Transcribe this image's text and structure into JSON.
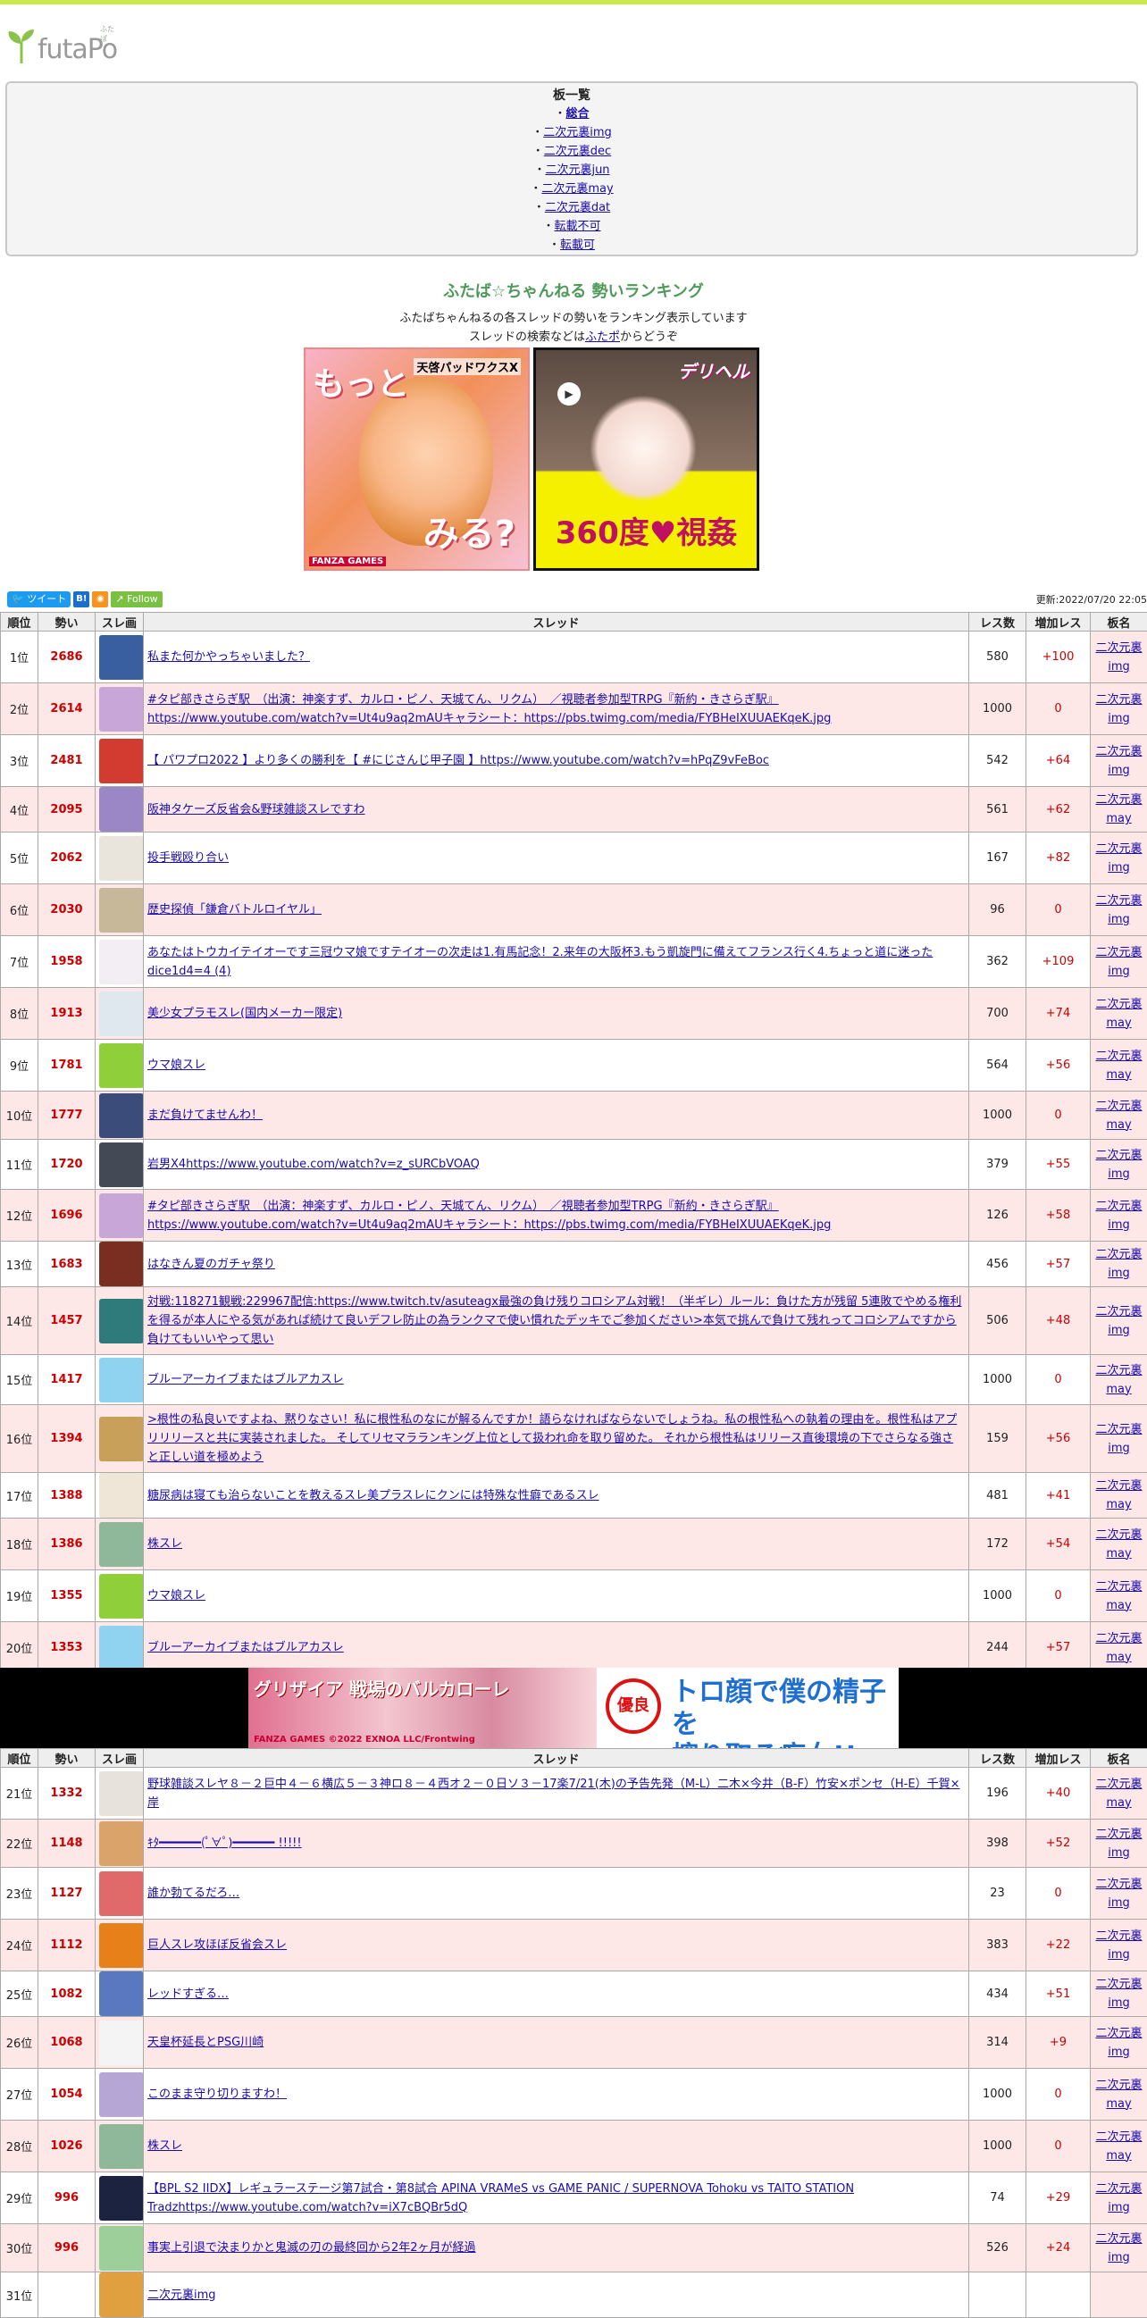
{
  "site": {
    "logo": "futaPo",
    "logo_sub": "ふたぽ",
    "updated": "更新:2022/07/20 22:05"
  },
  "boards": {
    "heading": "板一覧",
    "items": [
      {
        "label": "総合",
        "active": true
      },
      {
        "label": "二次元裏img"
      },
      {
        "label": "二次元裏dec"
      },
      {
        "label": "二次元裏jun"
      },
      {
        "label": "二次元裏may"
      },
      {
        "label": "二次元裏dat"
      },
      {
        "label": "転載不可"
      },
      {
        "label": "転載可"
      }
    ]
  },
  "ranking": {
    "title": "ふたば☆ちゃんねる 勢いランキング",
    "desc1": "ふたばちゃんねるの各スレッドの勢いをランキング表示しています",
    "desc2_pre": "スレッドの検索などは",
    "desc2_link": "ふたポ",
    "desc2_post": "からどうぞ"
  },
  "ads": {
    "ad1_big1": "もっと",
    "ad1_big2": "みる?",
    "ad1_small": "天啓パッドワクスX",
    "ad1_foot": "FANZA GAMES",
    "ad2_logo": "デリヘル",
    "ad2_big": "360度♥視姦",
    "mid_title": "グリザイア 戦場のバルカローレ",
    "mid_foot": "FANZA GAMES ©2022 EXNOA LLC/Frontwing",
    "mid_badge": "優良",
    "mid_line1": "トロ顔で僕の精子を",
    "mid_line2": "搾り取る痴女!!"
  },
  "social": {
    "tweet": "ツイート",
    "bi": "B!",
    "rss": "rss",
    "follow": "Follow"
  },
  "table_headers": {
    "rank": "順位",
    "power": "勢い",
    "img": "スレ画",
    "thread": "スレッド",
    "res": "レス数",
    "inc": "増加レス",
    "board": "板名"
  },
  "threads": [
    {
      "rank": "1位",
      "power": "2686",
      "title": "私また何かやっちゃいました？",
      "res": "580",
      "inc": "+100",
      "board": "二次元裏img",
      "thumb": "#3a5fa0"
    },
    {
      "rank": "2位",
      "power": "2614",
      "title": "#タピ部きさらぎ駅　（出演：神楽すず、カルロ・ピノ、天城てん、リクム）　／視聴者参加型TRPG『新約・きさらぎ駅』 https://www.youtube.com/watch?v=Ut4u9aq2mAUキャラシート：https://pbs.twimg.com/media/FYBHeIXUUAEKqeK.jpg",
      "res": "1000",
      "inc": "0",
      "board": "二次元裏img",
      "thumb": "#c9a6d8"
    },
    {
      "rank": "3位",
      "power": "2481",
      "title": "【 パワプロ2022 】より多くの勝利を【 #にじさんじ甲子園 】https://www.youtube.com/watch?v=hPqZ9vFeBoc",
      "res": "542",
      "inc": "+64",
      "board": "二次元裏img",
      "thumb": "#d23b2f"
    },
    {
      "rank": "4位",
      "power": "2095",
      "title": "阪神タケーズ反省会&野球雑談スレですわ",
      "res": "561",
      "inc": "+62",
      "board": "二次元裏may",
      "thumb": "#9b86c6"
    },
    {
      "rank": "5位",
      "power": "2062",
      "title": "投手戦殴り合い",
      "res": "167",
      "inc": "+82",
      "board": "二次元裏img",
      "thumb": "#e9e4dc"
    },
    {
      "rank": "6位",
      "power": "2030",
      "title": "歴史探偵「鎌倉バトルロイヤル」",
      "res": "96",
      "inc": "0",
      "board": "二次元裏img",
      "thumb": "#c8b89a"
    },
    {
      "rank": "7位",
      "power": "1958",
      "title": "あなたはトウカイテイオーです三冠ウマ娘ですテイオーの次走は1.有馬記念！2.来年の大阪杯3.もう凱旋門に備えてフランス行く4.ちょっと道に迷ったdice1d4=4 (4)",
      "res": "362",
      "inc": "+109",
      "board": "二次元裏img",
      "thumb": "#f3eef3"
    },
    {
      "rank": "8位",
      "power": "1913",
      "title": "美少女プラモスレ(国内メーカー限定)",
      "res": "700",
      "inc": "+74",
      "board": "二次元裏may",
      "thumb": "#dfe8ef"
    },
    {
      "rank": "9位",
      "power": "1781",
      "title": "ウマ娘スレ",
      "res": "564",
      "inc": "+56",
      "board": "二次元裏may",
      "thumb": "#8fcf3a"
    },
    {
      "rank": "10位",
      "power": "1777",
      "title": "まだ負けてませんわ！",
      "res": "1000",
      "inc": "0",
      "board": "二次元裏may",
      "thumb": "#3b4c7a"
    },
    {
      "rank": "11位",
      "power": "1720",
      "title": "岩男X4https://www.youtube.com/watch?v=z_sURCbVOAQ",
      "res": "379",
      "inc": "+55",
      "board": "二次元裏img",
      "thumb": "#444a55"
    },
    {
      "rank": "12位",
      "power": "1696",
      "title": "#タピ部きさらぎ駅　（出演：神楽すず、カルロ・ピノ、天城てん、リクム）　／視聴者参加型TRPG『新約・きさらぎ駅』 https://www.youtube.com/watch?v=Ut4u9aq2mAUキャラシート：https://pbs.twimg.com/media/FYBHeIXUUAEKqeK.jpg",
      "res": "126",
      "inc": "+58",
      "board": "二次元裏img",
      "thumb": "#c9a6d8"
    },
    {
      "rank": "13位",
      "power": "1683",
      "title": "はなきん夏のガチャ祭り",
      "res": "456",
      "inc": "+57",
      "board": "二次元裏img",
      "thumb": "#7a2e22"
    },
    {
      "rank": "14位",
      "power": "1457",
      "title": "対戦:118271観戦:229967配信:https://www.twitch.tv/asuteagx最強の負け残りコロシアム対戦！（半ギレ）ルール：負けた方が残留 5連敗でやめる権利を得るが本人にやる気があれば続けて良いデフレ防止の為ランクマで使い慣れたデッキでご参加ください>本気で挑んで負けて残れってコロシアムですから負けてもいいやって思い",
      "res": "506",
      "inc": "+48",
      "board": "二次元裏img",
      "thumb": "#2f7a7a"
    },
    {
      "rank": "15位",
      "power": "1417",
      "title": "ブルーアーカイブまたはブルアカスレ",
      "res": "1000",
      "inc": "0",
      "board": "二次元裏may",
      "thumb": "#8fd3f0"
    },
    {
      "rank": "16位",
      "power": "1394",
      "title": ">根性の私良いですよね、黙りなさい！私に根性私のなにが解るんですか！語らなければならないでしょうね。私の根性私への執着の理由を。根性私はアプリリリースと共に実装されました。 そしてリセマラランキング上位として扱われ命を取り留めた。 それから根性私はリリース直後環境の下でさらなる強さと正しい道を極めよう",
      "res": "159",
      "inc": "+56",
      "board": "二次元裏img",
      "thumb": "#c8a05a"
    },
    {
      "rank": "17位",
      "power": "1388",
      "title": "糖尿病は寝ても治らないことを教えるスレ美プラスレにクンには特殊な性癖であるスレ",
      "res": "481",
      "inc": "+41",
      "board": "二次元裏may",
      "thumb": "#efe6d8"
    },
    {
      "rank": "18位",
      "power": "1386",
      "title": "株スレ",
      "res": "172",
      "inc": "+54",
      "board": "二次元裏may",
      "thumb": "#8fb89a"
    },
    {
      "rank": "19位",
      "power": "1355",
      "title": "ウマ娘スレ",
      "res": "1000",
      "inc": "0",
      "board": "二次元裏may",
      "thumb": "#8fcf3a"
    },
    {
      "rank": "20位",
      "power": "1353",
      "title": "ブルーアーカイブまたはブルアカスレ",
      "res": "244",
      "inc": "+57",
      "board": "二次元裏may",
      "thumb": "#8fd3f0"
    },
    {
      "rank": "21位",
      "power": "1332",
      "title": "野球雑談スレヤ８－２巨中４－６横広５－３神ロ８－４西オ２－０日ソ３－17楽7/21(木)の予告先発（M-L）二木×今井（B-F）竹安×ポンセ（H-E）千賀×岸",
      "res": "196",
      "inc": "+40",
      "board": "二次元裏may",
      "thumb": "#e7e2dc"
    },
    {
      "rank": "22位",
      "power": "1148",
      "title": "ｷﾀ━━━━━━(ﾟ∀ﾟ)━━━━━━ !!!!!",
      "res": "398",
      "inc": "+52",
      "board": "二次元裏img",
      "thumb": "#d9a36a"
    },
    {
      "rank": "23位",
      "power": "1127",
      "title": "誰か勃てるだろ…",
      "res": "23",
      "inc": "0",
      "board": "二次元裏img",
      "thumb": "#e06a6a"
    },
    {
      "rank": "24位",
      "power": "1112",
      "title": "巨人スレ攻ほぼ反省会スレ",
      "res": "383",
      "inc": "+22",
      "board": "二次元裏img",
      "thumb": "#e8801a"
    },
    {
      "rank": "25位",
      "power": "1082",
      "title": "レッドすぎる…",
      "res": "434",
      "inc": "+51",
      "board": "二次元裏img",
      "thumb": "#5a78c0"
    },
    {
      "rank": "26位",
      "power": "1068",
      "title": "天皇杯延長とPSG川崎",
      "res": "314",
      "inc": "+9",
      "board": "二次元裏img",
      "thumb": "#f4f4f4"
    },
    {
      "rank": "27位",
      "power": "1054",
      "title": "このまま守り切りますわ！",
      "res": "1000",
      "inc": "0",
      "board": "二次元裏may",
      "thumb": "#b6a6d6"
    },
    {
      "rank": "28位",
      "power": "1026",
      "title": "株スレ",
      "res": "1000",
      "inc": "0",
      "board": "二次元裏may",
      "thumb": "#8fb89a"
    },
    {
      "rank": "29位",
      "power": "996",
      "title": "【BPL S2 IIDX】レギュラーステージ第7試合・第8試合 APINA VRAMeS vs GAME PANIC / SUPERNOVA Tohoku vs TAITO STATION Tradzhttps://www.youtube.com/watch?v=iX7cBQBr5dQ",
      "res": "74",
      "inc": "+29",
      "board": "二次元裏img",
      "thumb": "#1b2340"
    },
    {
      "rank": "30位",
      "power": "996",
      "title": "事実上引退で決まりかと鬼滅の刃の最終回から2年2ヶ月が経過",
      "res": "526",
      "inc": "+24",
      "board": "二次元裏img",
      "thumb": "#9ccf9a"
    },
    {
      "rank": "31位",
      "power": "",
      "title": "二次元裏img",
      "res": "",
      "inc": "",
      "board": "",
      "thumb": "#e0a040"
    }
  ]
}
